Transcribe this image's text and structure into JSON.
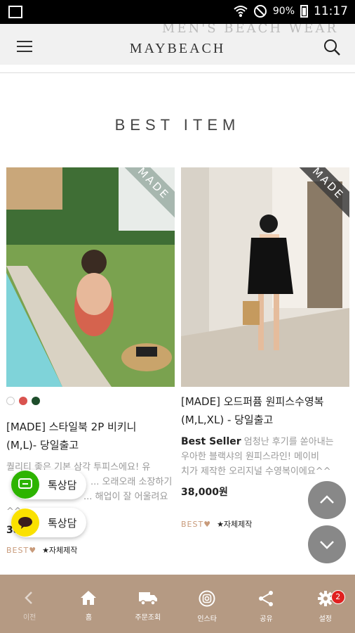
{
  "status_bar": {
    "battery_percent": "90%",
    "time": "11:17"
  },
  "header": {
    "background_text": "MEN'S BEACH WEAR",
    "logo": "MAYBEACH"
  },
  "section_title": "BEST ITEM",
  "products": [
    {
      "badge": "MADE",
      "colors": [
        "#ffffff",
        "#d9534f",
        "#1e4d2b"
      ],
      "name_line1": "[MADE] 스타일북 2P 비키니",
      "name_line2": "(M,L)- 당일출고",
      "desc_lines": [
        "퀄리티 좋은 기본 삼각 투피스에요! 유",
        "... 오래오래 소장하기",
        "... 해업이 잘 어울려요",
        "^^"
      ],
      "price": "38,...",
      "tag_best": "BEST♥",
      "tag_made": "★자체제작"
    },
    {
      "badge": "MADE",
      "name_line1": "[MADE] 오드퍼퓸 원피스수영복",
      "name_line2": "(M,L,XL) - 당일출고",
      "desc_highlight": "Best Seller",
      "desc_lines": [
        " 엄청난 후기를 쏟아내는",
        "우아한 블랙샤의 원피스라인! 메이비",
        "치가 제작한 오리지널 수영복이에요^^"
      ],
      "price": "38,000원",
      "tag_best": "BEST♥",
      "tag_made": "★자체제작"
    }
  ],
  "chat_buttons": [
    {
      "label": "톡상담",
      "color": "#2db400"
    },
    {
      "label": "톡상담",
      "color": "#fae100"
    }
  ],
  "bottom_nav": [
    {
      "label": "이전",
      "icon": "chevron-left-icon"
    },
    {
      "label": "홈",
      "icon": "home-icon"
    },
    {
      "label": "주문조회",
      "icon": "truck-icon"
    },
    {
      "label": "인스타",
      "icon": "instagram-icon"
    },
    {
      "label": "공유",
      "icon": "share-icon"
    },
    {
      "label": "설정",
      "icon": "gear-icon",
      "badge": "2"
    }
  ]
}
